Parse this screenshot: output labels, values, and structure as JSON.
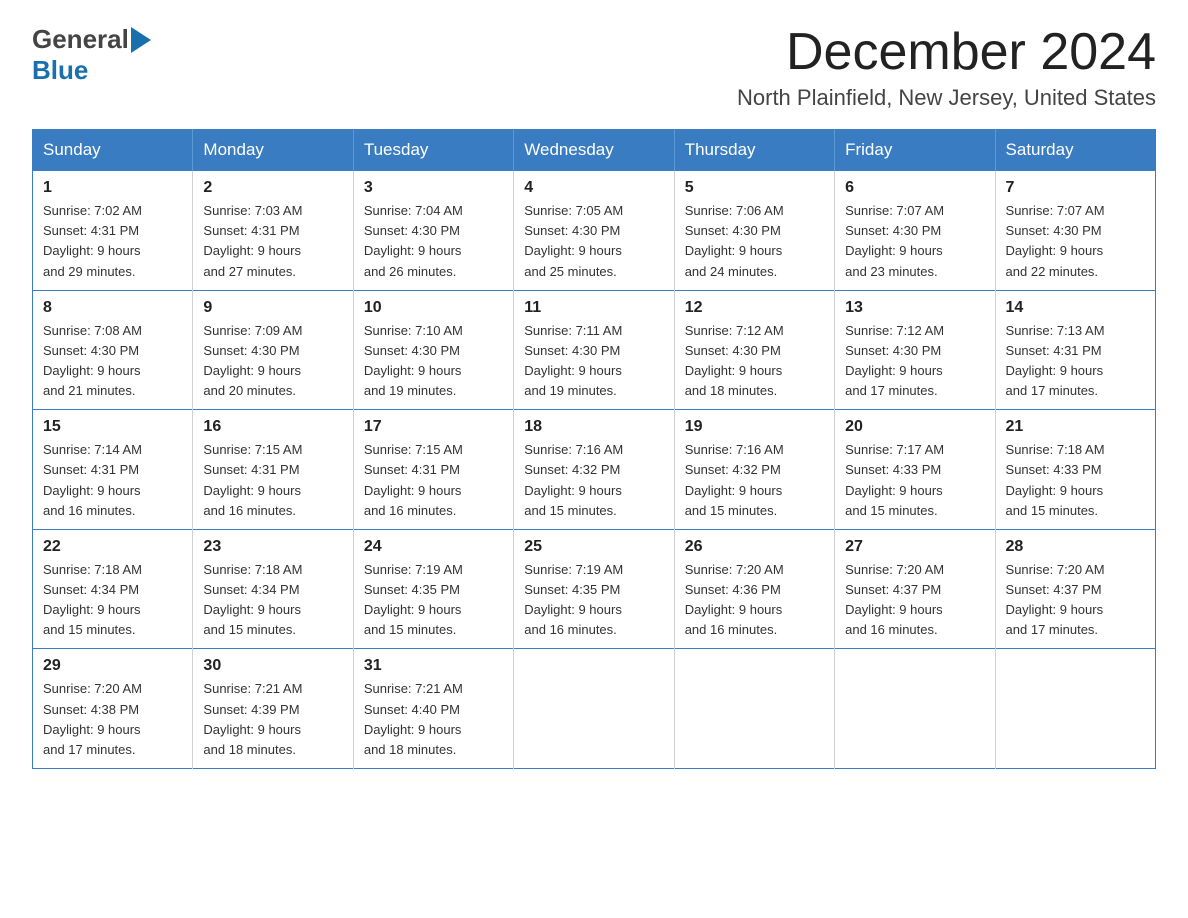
{
  "header": {
    "logo_general": "General",
    "logo_blue": "Blue",
    "month_title": "December 2024",
    "location": "North Plainfield, New Jersey, United States"
  },
  "weekdays": [
    "Sunday",
    "Monday",
    "Tuesday",
    "Wednesday",
    "Thursday",
    "Friday",
    "Saturday"
  ],
  "weeks": [
    [
      {
        "day": "1",
        "sunrise": "Sunrise: 7:02 AM",
        "sunset": "Sunset: 4:31 PM",
        "daylight": "Daylight: 9 hours",
        "daylight2": "and 29 minutes."
      },
      {
        "day": "2",
        "sunrise": "Sunrise: 7:03 AM",
        "sunset": "Sunset: 4:31 PM",
        "daylight": "Daylight: 9 hours",
        "daylight2": "and 27 minutes."
      },
      {
        "day": "3",
        "sunrise": "Sunrise: 7:04 AM",
        "sunset": "Sunset: 4:30 PM",
        "daylight": "Daylight: 9 hours",
        "daylight2": "and 26 minutes."
      },
      {
        "day": "4",
        "sunrise": "Sunrise: 7:05 AM",
        "sunset": "Sunset: 4:30 PM",
        "daylight": "Daylight: 9 hours",
        "daylight2": "and 25 minutes."
      },
      {
        "day": "5",
        "sunrise": "Sunrise: 7:06 AM",
        "sunset": "Sunset: 4:30 PM",
        "daylight": "Daylight: 9 hours",
        "daylight2": "and 24 minutes."
      },
      {
        "day": "6",
        "sunrise": "Sunrise: 7:07 AM",
        "sunset": "Sunset: 4:30 PM",
        "daylight": "Daylight: 9 hours",
        "daylight2": "and 23 minutes."
      },
      {
        "day": "7",
        "sunrise": "Sunrise: 7:07 AM",
        "sunset": "Sunset: 4:30 PM",
        "daylight": "Daylight: 9 hours",
        "daylight2": "and 22 minutes."
      }
    ],
    [
      {
        "day": "8",
        "sunrise": "Sunrise: 7:08 AM",
        "sunset": "Sunset: 4:30 PM",
        "daylight": "Daylight: 9 hours",
        "daylight2": "and 21 minutes."
      },
      {
        "day": "9",
        "sunrise": "Sunrise: 7:09 AM",
        "sunset": "Sunset: 4:30 PM",
        "daylight": "Daylight: 9 hours",
        "daylight2": "and 20 minutes."
      },
      {
        "day": "10",
        "sunrise": "Sunrise: 7:10 AM",
        "sunset": "Sunset: 4:30 PM",
        "daylight": "Daylight: 9 hours",
        "daylight2": "and 19 minutes."
      },
      {
        "day": "11",
        "sunrise": "Sunrise: 7:11 AM",
        "sunset": "Sunset: 4:30 PM",
        "daylight": "Daylight: 9 hours",
        "daylight2": "and 19 minutes."
      },
      {
        "day": "12",
        "sunrise": "Sunrise: 7:12 AM",
        "sunset": "Sunset: 4:30 PM",
        "daylight": "Daylight: 9 hours",
        "daylight2": "and 18 minutes."
      },
      {
        "day": "13",
        "sunrise": "Sunrise: 7:12 AM",
        "sunset": "Sunset: 4:30 PM",
        "daylight": "Daylight: 9 hours",
        "daylight2": "and 17 minutes."
      },
      {
        "day": "14",
        "sunrise": "Sunrise: 7:13 AM",
        "sunset": "Sunset: 4:31 PM",
        "daylight": "Daylight: 9 hours",
        "daylight2": "and 17 minutes."
      }
    ],
    [
      {
        "day": "15",
        "sunrise": "Sunrise: 7:14 AM",
        "sunset": "Sunset: 4:31 PM",
        "daylight": "Daylight: 9 hours",
        "daylight2": "and 16 minutes."
      },
      {
        "day": "16",
        "sunrise": "Sunrise: 7:15 AM",
        "sunset": "Sunset: 4:31 PM",
        "daylight": "Daylight: 9 hours",
        "daylight2": "and 16 minutes."
      },
      {
        "day": "17",
        "sunrise": "Sunrise: 7:15 AM",
        "sunset": "Sunset: 4:31 PM",
        "daylight": "Daylight: 9 hours",
        "daylight2": "and 16 minutes."
      },
      {
        "day": "18",
        "sunrise": "Sunrise: 7:16 AM",
        "sunset": "Sunset: 4:32 PM",
        "daylight": "Daylight: 9 hours",
        "daylight2": "and 15 minutes."
      },
      {
        "day": "19",
        "sunrise": "Sunrise: 7:16 AM",
        "sunset": "Sunset: 4:32 PM",
        "daylight": "Daylight: 9 hours",
        "daylight2": "and 15 minutes."
      },
      {
        "day": "20",
        "sunrise": "Sunrise: 7:17 AM",
        "sunset": "Sunset: 4:33 PM",
        "daylight": "Daylight: 9 hours",
        "daylight2": "and 15 minutes."
      },
      {
        "day": "21",
        "sunrise": "Sunrise: 7:18 AM",
        "sunset": "Sunset: 4:33 PM",
        "daylight": "Daylight: 9 hours",
        "daylight2": "and 15 minutes."
      }
    ],
    [
      {
        "day": "22",
        "sunrise": "Sunrise: 7:18 AM",
        "sunset": "Sunset: 4:34 PM",
        "daylight": "Daylight: 9 hours",
        "daylight2": "and 15 minutes."
      },
      {
        "day": "23",
        "sunrise": "Sunrise: 7:18 AM",
        "sunset": "Sunset: 4:34 PM",
        "daylight": "Daylight: 9 hours",
        "daylight2": "and 15 minutes."
      },
      {
        "day": "24",
        "sunrise": "Sunrise: 7:19 AM",
        "sunset": "Sunset: 4:35 PM",
        "daylight": "Daylight: 9 hours",
        "daylight2": "and 15 minutes."
      },
      {
        "day": "25",
        "sunrise": "Sunrise: 7:19 AM",
        "sunset": "Sunset: 4:35 PM",
        "daylight": "Daylight: 9 hours",
        "daylight2": "and 16 minutes."
      },
      {
        "day": "26",
        "sunrise": "Sunrise: 7:20 AM",
        "sunset": "Sunset: 4:36 PM",
        "daylight": "Daylight: 9 hours",
        "daylight2": "and 16 minutes."
      },
      {
        "day": "27",
        "sunrise": "Sunrise: 7:20 AM",
        "sunset": "Sunset: 4:37 PM",
        "daylight": "Daylight: 9 hours",
        "daylight2": "and 16 minutes."
      },
      {
        "day": "28",
        "sunrise": "Sunrise: 7:20 AM",
        "sunset": "Sunset: 4:37 PM",
        "daylight": "Daylight: 9 hours",
        "daylight2": "and 17 minutes."
      }
    ],
    [
      {
        "day": "29",
        "sunrise": "Sunrise: 7:20 AM",
        "sunset": "Sunset: 4:38 PM",
        "daylight": "Daylight: 9 hours",
        "daylight2": "and 17 minutes."
      },
      {
        "day": "30",
        "sunrise": "Sunrise: 7:21 AM",
        "sunset": "Sunset: 4:39 PM",
        "daylight": "Daylight: 9 hours",
        "daylight2": "and 18 minutes."
      },
      {
        "day": "31",
        "sunrise": "Sunrise: 7:21 AM",
        "sunset": "Sunset: 4:40 PM",
        "daylight": "Daylight: 9 hours",
        "daylight2": "and 18 minutes."
      },
      null,
      null,
      null,
      null
    ]
  ]
}
